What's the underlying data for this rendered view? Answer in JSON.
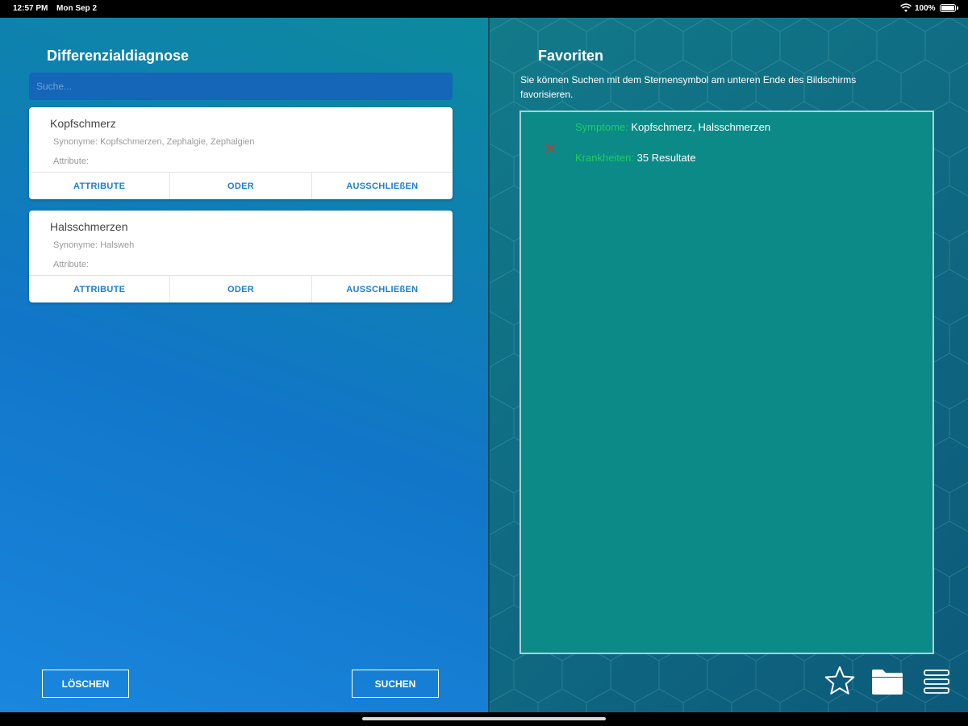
{
  "status_bar": {
    "time": "12:57 PM",
    "date": "Mon Sep 2",
    "battery": "100%"
  },
  "left": {
    "title": "Differenzialdiagnose",
    "search": {
      "placeholder": "Suche...",
      "value": ""
    },
    "cards": [
      {
        "name": "Kopfschmerz",
        "synonyms": "Synonyme: Kopfschmerzen, Zephalgie, Zephalgien",
        "attributes": "Attribute:",
        "actions": [
          "ATTRIBUTE",
          "ODER",
          "AUSSCHLIEßEN"
        ]
      },
      {
        "name": "Halsschmerzen",
        "synonyms": "Synonyme: Halsweh",
        "attributes": "Attribute:",
        "actions": [
          "ATTRIBUTE",
          "ODER",
          "AUSSCHLIEßEN"
        ]
      }
    ],
    "clear_label": "LÖSCHEN",
    "search_label": "SUCHEN"
  },
  "right": {
    "title": "Favoriten",
    "description": "Sie können Suchen mit dem Sternensymbol am unteren Ende des Bildschirms favorisieren.",
    "favorites": [
      {
        "symptoms_key": "Symptome:",
        "symptoms_value": "Kopfschmerz, Halsschmerzen",
        "diseases_key": "Krankheiten:",
        "diseases_value": "35 Resultate"
      }
    ],
    "toolbar_icons": [
      "star-icon",
      "folder-icon",
      "menu-icon"
    ]
  },
  "colors": {
    "accent_blue": "#1a7fd0",
    "fav_key_green": "#1fcc66",
    "remove_red": "#d9302a",
    "fav_box": "#0b8a88"
  }
}
